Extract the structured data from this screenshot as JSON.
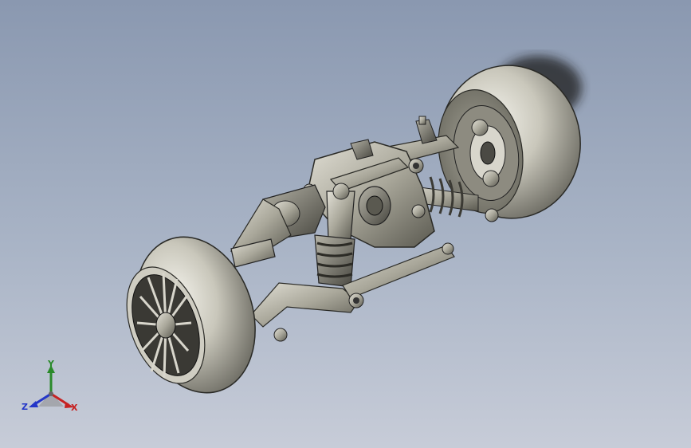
{
  "viewport": {
    "background_top": "#8a98b0",
    "background_bottom": "#c7ccd8"
  },
  "model": {
    "subject": "rear-axle-suspension-assembly",
    "wheel_color": "#c5c3b6",
    "part_color": "#a8a699",
    "edge_color": "#2a2a26"
  },
  "triad": {
    "y_label": "Y",
    "z_label": "Z",
    "x_label": "X",
    "y_color": "#2a8a2a",
    "z_color": "#2436c8",
    "x_color": "#c62222"
  }
}
